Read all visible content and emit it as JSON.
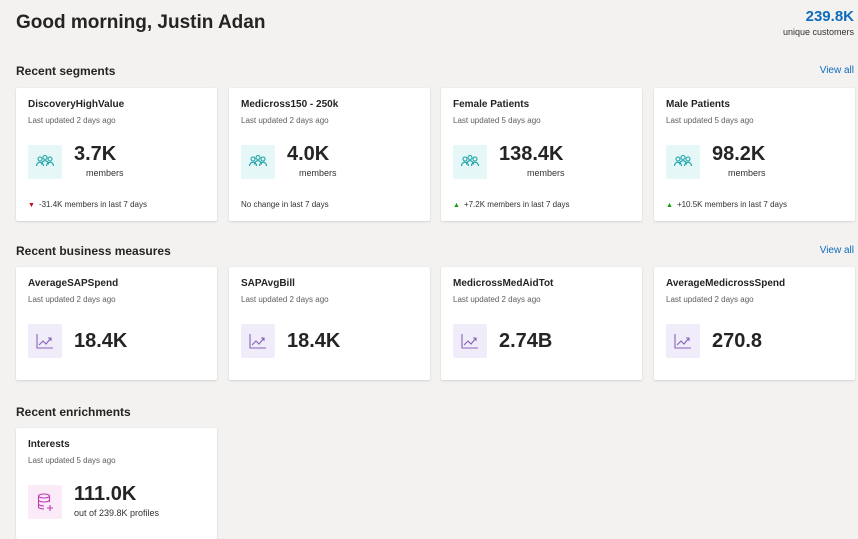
{
  "header": {
    "greeting": "Good morning, Justin Adan",
    "unique_customers_value": "239.8K",
    "unique_customers_label": "unique customers"
  },
  "segments": {
    "title": "Recent segments",
    "view_all": "View all",
    "unit_label": "members",
    "items": [
      {
        "name": "DiscoveryHighValue",
        "updated": "Last updated 2 days ago",
        "value": "3.7K",
        "trend_dir": "down",
        "trend_text": "-31.4K members in last 7 days"
      },
      {
        "name": "Medicross150 - 250k",
        "updated": "Last updated 2 days ago",
        "value": "4.0K",
        "trend_dir": "none",
        "trend_text": "No change in last 7 days"
      },
      {
        "name": "Female Patients",
        "updated": "Last updated 5 days ago",
        "value": "138.4K",
        "trend_dir": "up",
        "trend_text": "+7.2K members in last 7 days"
      },
      {
        "name": "Male Patients",
        "updated": "Last updated 5 days ago",
        "value": "98.2K",
        "trend_dir": "up",
        "trend_text": "+10.5K members in last 7 days"
      }
    ]
  },
  "measures": {
    "title": "Recent business measures",
    "view_all": "View all",
    "items": [
      {
        "name": "AverageSAPSpend",
        "updated": "Last updated 2 days ago",
        "value": "18.4K"
      },
      {
        "name": "SAPAvgBill",
        "updated": "Last updated 2 days ago",
        "value": "18.4K"
      },
      {
        "name": "MedicrossMedAidTot",
        "updated": "Last updated 2 days ago",
        "value": "2.74B"
      },
      {
        "name": "AverageMedicrossSpend",
        "updated": "Last updated 2 days ago",
        "value": "270.8"
      }
    ]
  },
  "enrichments": {
    "title": "Recent enrichments",
    "items": [
      {
        "name": "Interests",
        "updated": "Last updated 5 days ago",
        "value": "111.0K",
        "detail": "out of 239.8K profiles"
      }
    ]
  },
  "colors": {
    "accent": "#0f6cbd",
    "segment_icon": "#1aa3a8",
    "measure_icon": "#8764b8",
    "enrichment_icon": "#c239b3",
    "trend_up": "#13a10e",
    "trend_down": "#c50f1f"
  },
  "icons": {
    "segment": "people-group-icon",
    "measure": "line-chart-icon",
    "enrichment": "database-add-icon"
  }
}
